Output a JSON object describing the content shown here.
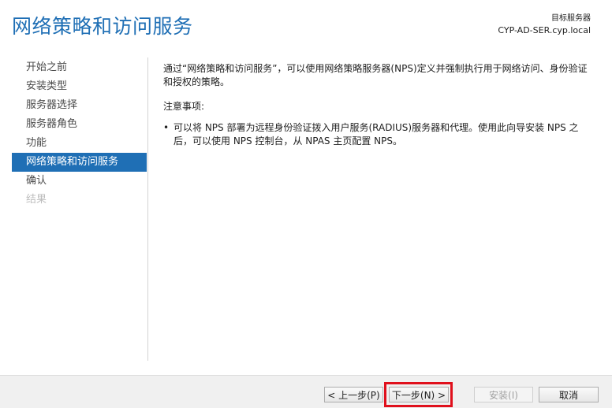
{
  "header": {
    "title": "网络策略和访问服务",
    "server_label": "目标服务器",
    "server_name": "CYP-AD-SER.cyp.local"
  },
  "nav": {
    "items": [
      {
        "label": "开始之前"
      },
      {
        "label": "安装类型"
      },
      {
        "label": "服务器选择"
      },
      {
        "label": "服务器角色"
      },
      {
        "label": "功能"
      },
      {
        "label": "网络策略和访问服务"
      },
      {
        "label": "确认"
      },
      {
        "label": "结果"
      }
    ],
    "active_index": 5,
    "disabled_index": 7
  },
  "content": {
    "intro": "通过“网络策略和访问服务”，可以使用网络策略服务器(NPS)定义并强制执行用于网络访问、身份验证和授权的策略。",
    "notes_title": "注意事项:",
    "bullet_char": "•",
    "note_1": "可以将 NPS 部署为远程身份验证拨入用户服务(RADIUS)服务器和代理。使用此向导安装 NPS 之后，可以使用 NPS 控制台，从 NPAS 主页配置 NPS。"
  },
  "footer": {
    "prev_label": "< 上一步(P)",
    "next_label": "下一步(N) >",
    "install_label": "安装(I)",
    "cancel_label": "取消"
  },
  "colors": {
    "accent": "#1f6fb5",
    "highlight": "#e0101c"
  }
}
